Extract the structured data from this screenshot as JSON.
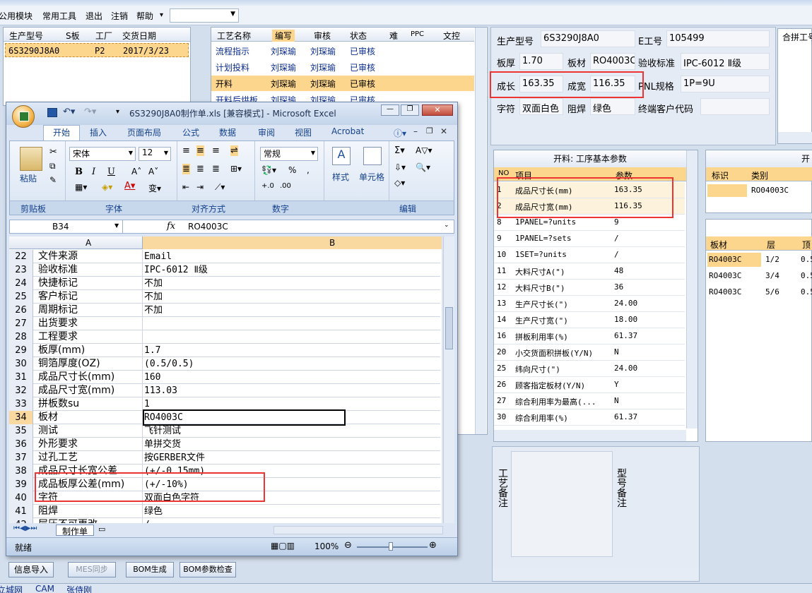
{
  "menu": {
    "items": [
      "公用模块",
      "常用工具",
      "退出",
      "注销",
      "帮助"
    ],
    "help_arrow": "▾",
    "combo_value": ""
  },
  "order_list": {
    "headers": [
      "生产型号",
      "S板",
      "工厂",
      "交货日期"
    ],
    "rows": [
      [
        "6S3290J8A0",
        "",
        "P2",
        "2017/3/23"
      ]
    ]
  },
  "process_list": {
    "headers": [
      "工艺名称",
      "编写",
      "审核",
      "状态",
      "难",
      "PPC",
      "文控"
    ],
    "rows": [
      [
        "流程指示",
        "刘琛瑜",
        "刘琛瑜",
        "已审核"
      ],
      [
        "计划投料",
        "刘琛瑜",
        "刘琛瑜",
        "已审核"
      ],
      [
        "开料",
        "刘琛瑜",
        "刘琛瑜",
        "已审核"
      ],
      [
        "开料后烘板",
        "刘琛瑜",
        "刘琛瑜",
        "已审核"
      ]
    ]
  },
  "info": {
    "model_label": "生产型号",
    "model": "6S3290J8A0",
    "eng_label": "E工号",
    "eng": "105499",
    "thick_label": "板厚",
    "thick": "1.70",
    "mat_label": "板材",
    "mat": "RO4003C",
    "std_label": "验收标准",
    "std": "IPC-6012 Ⅱ级",
    "len_label": "成长",
    "len": "163.35",
    "wid_label": "成宽",
    "wid": "116.35",
    "pnl_label": "PNL规格",
    "pnl": "1P=9U",
    "silk_label": "字符",
    "silk": "双面白色",
    "mask_label": "阻焊",
    "mask": "绿色",
    "cust_label": "终端客户代码",
    "cust": ""
  },
  "merge_panel": {
    "title": "合拼工号"
  },
  "params": {
    "title": "开料: 工序基本参数",
    "headers": [
      "NO",
      "项目",
      "参数"
    ],
    "rows": [
      [
        "1",
        "成品尺寸长(mm)",
        "163.35"
      ],
      [
        "2",
        "成品尺寸宽(mm)",
        "116.35"
      ],
      [
        "8",
        "1PANEL=?units",
        "9"
      ],
      [
        "9",
        "1PANEL=?sets",
        "/"
      ],
      [
        "10",
        "1SET=?units",
        "/"
      ],
      [
        "11",
        "大料尺寸A(\")",
        "48"
      ],
      [
        "12",
        "大料尺寸B(\")",
        "36"
      ],
      [
        "13",
        "生产尺寸长(\")",
        "24.00"
      ],
      [
        "14",
        "生产尺寸宽(\")",
        "18.00"
      ],
      [
        "16",
        "拼板利用率(%)",
        "61.37"
      ],
      [
        "20",
        "小交货面积拼板(Y/N)",
        "N"
      ],
      [
        "25",
        "纬向尺寸(\")",
        "24.00"
      ],
      [
        "26",
        "顾客指定板材(Y/N)",
        "Y"
      ],
      [
        "27",
        "综合利用率为最高(...",
        "N"
      ],
      [
        "30",
        "综合利用率(%)",
        "61.37"
      ]
    ]
  },
  "right_panel": {
    "title": "开",
    "headers": [
      "标识",
      "类别"
    ],
    "row": [
      "",
      "RO04003C"
    ]
  },
  "layers": {
    "headers": [
      "板材",
      "层",
      "顶"
    ],
    "rows": [
      [
        "RO4003C",
        "1/2",
        "0.5"
      ],
      [
        "RO4003C",
        "3/4",
        "0.5"
      ],
      [
        "RO4003C",
        "5/6",
        "0.5"
      ]
    ]
  },
  "notes": {
    "process_note": "工艺备注",
    "model_note": "型号备注"
  },
  "buttons": {
    "info_import": "信息导入",
    "mes_sync": "MES同步",
    "bom_gen": "BOM生成",
    "bom_check": "BOM参数检查"
  },
  "taskbar": [
    "立城网",
    "CAM",
    "张侍刚"
  ],
  "excel": {
    "title": "6S3290J8A0制作单.xls  [兼容模式] - Microsoft Excel",
    "tabs": [
      "开始",
      "插入",
      "页面布局",
      "公式",
      "数据",
      "审阅",
      "视图",
      "Acrobat"
    ],
    "font_name": "宋体",
    "font_size": "12",
    "num_format": "常规",
    "paste": "粘贴",
    "style": "样式",
    "cells": "单元格",
    "groups": [
      "剪贴板",
      "字体",
      "对齐方式",
      "数字",
      "编辑"
    ],
    "name_box": "B34",
    "fx": "fx",
    "formula": "RO4003C",
    "col_headers": [
      "A",
      "B"
    ],
    "rows": [
      [
        "22",
        "文件来源",
        "Email"
      ],
      [
        "23",
        "验收标准",
        "IPC-6012 Ⅱ级"
      ],
      [
        "24",
        "快捷标记",
        "不加"
      ],
      [
        "25",
        "客户标记",
        "不加"
      ],
      [
        "26",
        "周期标记",
        "不加"
      ],
      [
        "27",
        "出货要求",
        ""
      ],
      [
        "28",
        "工程要求",
        ""
      ],
      [
        "29",
        "板厚(mm)",
        "1.7"
      ],
      [
        "30",
        "铜箔厚度(OZ)",
        "(0.5/0.5)"
      ],
      [
        "31",
        "成品尺寸长(mm)",
        "160"
      ],
      [
        "32",
        "成品尺寸宽(mm)",
        "113.03"
      ],
      [
        "33",
        "拼板数su",
        "1"
      ],
      [
        "34",
        "板材",
        "RO4003C"
      ],
      [
        "35",
        "测试",
        "飞针测试"
      ],
      [
        "36",
        "外形要求",
        "单拼交货"
      ],
      [
        "37",
        "过孔工艺",
        "按GERBER文件"
      ],
      [
        "38",
        "成品尺寸长宽公差",
        "(+/-0.15mm)"
      ],
      [
        "39",
        "成品板厚公差(mm)",
        "(+/-10%)"
      ],
      [
        "40",
        "字符",
        "双面白色字符"
      ],
      [
        "41",
        "阻焊",
        "绿色"
      ],
      [
        "42",
        "层压不可更改",
        "/"
      ]
    ],
    "sheet_tab": "制作单",
    "status": "就绪",
    "zoom": "100%"
  }
}
